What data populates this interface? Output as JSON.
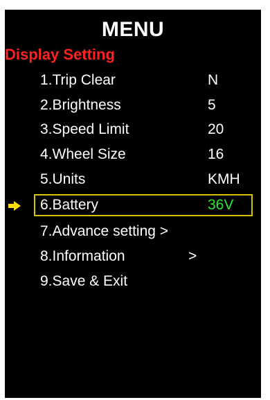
{
  "menu": {
    "title": "MENU",
    "section": "Display Setting",
    "items": [
      {
        "label": "1.Trip Clear",
        "value": "N"
      },
      {
        "label": "2.Brightness",
        "value": "5"
      },
      {
        "label": "3.Speed Limit",
        "value": "20"
      },
      {
        "label": "4.Wheel Size",
        "value": "16"
      },
      {
        "label": "5.Units",
        "value": "KMH"
      },
      {
        "label": "6.Battery",
        "value": "36V"
      },
      {
        "label": "7.Advance setting >",
        "value": ""
      },
      {
        "label": "8.Information",
        "value": "",
        "arrow": ">"
      },
      {
        "label": "9.Save & Exit",
        "value": ""
      }
    ],
    "selected_index": 5
  },
  "colors": {
    "background": "#000000",
    "section": "#ff2020",
    "selected_value": "#2ee82e",
    "selection_border": "#d8c200",
    "pointer": "#ffe000"
  },
  "icons": {
    "pointer": "right-arrow-icon"
  }
}
